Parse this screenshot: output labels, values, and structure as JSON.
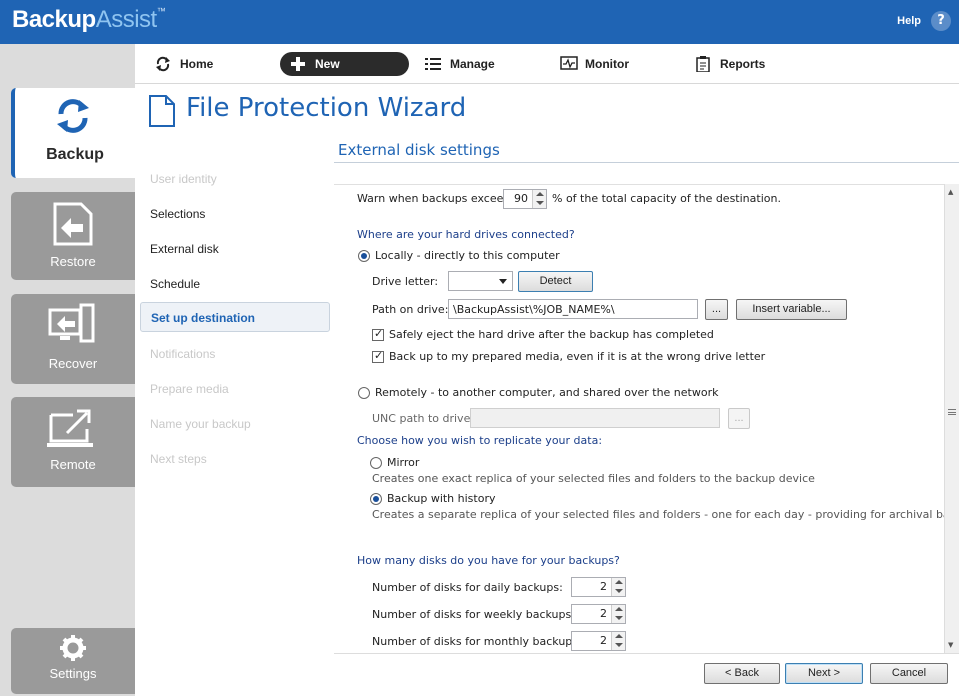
{
  "app": {
    "logo_bold": "Backup",
    "logo_light": "Assist",
    "logo_tm": "™",
    "help_label": "Help",
    "help_icon": "?"
  },
  "leftrail": {
    "tiles": [
      {
        "label": "Backup",
        "icon": "sync-icon",
        "active": true
      },
      {
        "label": "Restore",
        "icon": "restore-icon"
      },
      {
        "label": "Recover",
        "icon": "recover-icon"
      },
      {
        "label": "Remote",
        "icon": "remote-icon"
      },
      {
        "label": "Settings",
        "icon": "gear-icon"
      }
    ]
  },
  "navbar": {
    "items": [
      {
        "label": "Home",
        "icon": "refresh-icon"
      },
      {
        "label": "New",
        "icon": "plus-icon"
      },
      {
        "label": "Manage",
        "icon": "list-icon"
      },
      {
        "label": "Monitor",
        "icon": "monitor-icon"
      },
      {
        "label": "Reports",
        "icon": "clipboard-icon"
      }
    ]
  },
  "wizard": {
    "title": "File Protection Wizard",
    "steps": [
      {
        "label": "User identity",
        "state": "todo"
      },
      {
        "label": "Selections",
        "state": "done"
      },
      {
        "label": "External disk",
        "state": "done"
      },
      {
        "label": "Schedule",
        "state": "done"
      },
      {
        "label": "Set up destination",
        "state": "current"
      },
      {
        "label": "Notifications",
        "state": "todo"
      },
      {
        "label": "Prepare media",
        "state": "todo"
      },
      {
        "label": "Name your backup",
        "state": "todo"
      },
      {
        "label": "Next steps",
        "state": "todo"
      }
    ]
  },
  "section": {
    "title": "External disk settings",
    "warn_prefix": "Warn when backups exceed",
    "warn_value": "90",
    "warn_suffix": "% of the total capacity of the destination.",
    "q_connected": "Where are your hard drives connected?",
    "opt_local": "Locally - directly to this computer",
    "drive_letter_label": "Drive letter:",
    "drive_letter_value": "",
    "detect_label": "Detect",
    "path_label": "Path on drive:",
    "path_value": "\\BackupAssist\\%JOB_NAME%\\",
    "browse_label": "...",
    "insert_variable_label": "Insert variable...",
    "chk_eject": "Safely eject the hard drive after the backup has completed",
    "chk_prepared": "Back up to my prepared media, even if it is at the wrong drive letter",
    "opt_remote": "Remotely - to another computer, and shared over the network",
    "unc_label": "UNC path to drive:",
    "unc_value": "",
    "unc_browse_label": "...",
    "q_replicate": "Choose how you wish to replicate your data:",
    "opt_mirror": "Mirror",
    "mirror_desc": "Creates one exact replica of your selected files and folders to the backup device",
    "opt_history": "Backup with history",
    "history_desc": "Creates a separate replica of your selected files and folders - one for each day - providing for archival backups",
    "q_disks": "How many disks do you have for your backups?",
    "daily_label": "Number of disks for daily backups:",
    "daily_value": "2",
    "weekly_label": "Number of disks for weekly backups:",
    "weekly_value": "2",
    "monthly_label": "Number of disks for monthly backups:",
    "monthly_value": "2"
  },
  "footer": {
    "back_label": "< Back",
    "next_label": "Next >",
    "cancel_label": "Cancel"
  },
  "colors": {
    "brand_blue": "#1f64b4",
    "tile_gray": "#9a9a9a",
    "rail_bg": "#dcdcdc"
  }
}
